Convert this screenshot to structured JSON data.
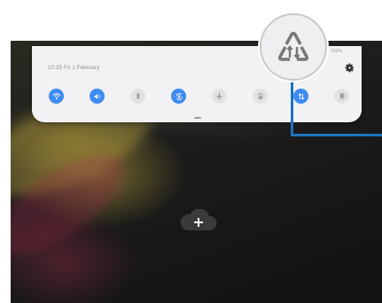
{
  "quick_panel": {
    "datetime": "10:25 Fri 1 February",
    "status": "100%",
    "settings_icon": "gear-icon"
  },
  "toggles": [
    {
      "name": "wifi",
      "icon": "wifi-icon",
      "state": "on"
    },
    {
      "name": "sound",
      "icon": "sound-icon",
      "state": "on"
    },
    {
      "name": "bluetooth",
      "icon": "bluetooth-icon",
      "state": "off"
    },
    {
      "name": "auto-rotate",
      "icon": "rotate-icon",
      "state": "on"
    },
    {
      "name": "airplane-mode",
      "icon": "airplane-icon",
      "state": "off"
    },
    {
      "name": "power-saving",
      "icon": "battery-icon",
      "state": "off"
    },
    {
      "name": "mobile-data",
      "icon": "data-arrows-icon",
      "state": "on"
    },
    {
      "name": "tablet-device",
      "icon": "tablet-icon",
      "state": "off"
    }
  ],
  "callout": {
    "icon": "data-saver-icon",
    "accent": "#1e73be"
  },
  "home": {
    "add_icon": "cloud-plus-icon"
  },
  "colors": {
    "toggle_on": "#3e8cf2",
    "toggle_off": "#e2e2e5",
    "panel_bg": "#f2f2f4"
  }
}
